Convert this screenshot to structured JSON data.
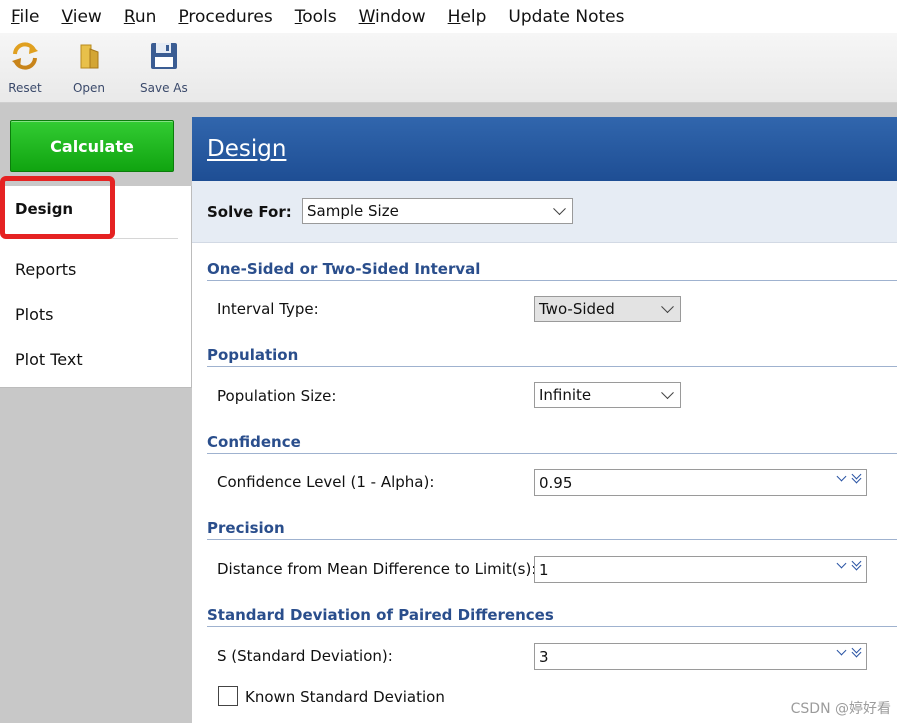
{
  "menu": [
    {
      "underline": "F",
      "rest": "ile"
    },
    {
      "underline": "V",
      "rest": "iew"
    },
    {
      "underline": "R",
      "rest": "un"
    },
    {
      "underline": "P",
      "rest": "rocedures"
    },
    {
      "underline": "T",
      "rest": "ools"
    },
    {
      "underline": "W",
      "rest": "indow"
    },
    {
      "underline": "H",
      "rest": "elp"
    },
    {
      "underline": "",
      "rest": "Update Notes"
    }
  ],
  "toolbar": {
    "reset": "Reset",
    "open": "Open",
    "save_as": "Save As"
  },
  "left": {
    "calculate": "Calculate",
    "nav": {
      "design": "Design",
      "reports": "Reports",
      "plots": "Plots",
      "plot_text": "Plot Text"
    }
  },
  "panel": {
    "title": "Design",
    "solve_for_label": "Solve For:",
    "solve_for_value": "Sample Size",
    "sections": {
      "interval": "One-Sided or Two-Sided Interval",
      "population": "Population",
      "confidence": "Confidence",
      "precision": "Precision",
      "stddev": "Standard Deviation of Paired Differences"
    },
    "fields": {
      "interval_type_label": "Interval Type:",
      "interval_type_value": "Two-Sided",
      "population_size_label": "Population Size:",
      "population_size_value": "Infinite",
      "confidence_label": "Confidence Level (1 - Alpha):",
      "confidence_value": "0.95",
      "distance_label": "Distance from Mean Difference to Limit(s):",
      "distance_value": "1",
      "s_label": "S (Standard Deviation):",
      "s_value": "3",
      "known_sd_label": "Known Standard Deviation"
    }
  },
  "watermark": "CSDN @婷好看",
  "colors": {
    "header_blue": "#2a5aa0",
    "calculate_green": "#22b822",
    "section_blue": "#2a4e8c",
    "highlight_red": "#e52222"
  }
}
